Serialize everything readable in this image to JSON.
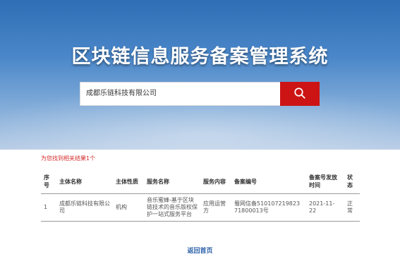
{
  "header": {
    "title": "区块链信息服务备案管理系统"
  },
  "search": {
    "value": "成都乐链科技有限公司",
    "button_icon": "search-icon",
    "button_color": "#cc1414"
  },
  "results": {
    "count_text": "为您找到相关结果1个",
    "columns": [
      "序号",
      "主体名称",
      "主体性质",
      "服务名称",
      "服务内容",
      "备案编号",
      "备案号发放时间",
      "状态"
    ],
    "rows": [
      {
        "seq": "1",
        "name": "成都乐链科技有限公司",
        "nature": "机构",
        "service": "音乐蜜蜂-基于区块链技术的音乐版权保护一站式服务平台",
        "content": "应用运营方",
        "record_no": "蜀网信备51010721982371800013号",
        "date": "2021-11-22",
        "status": "正常"
      }
    ]
  },
  "footer": {
    "back_label": "返回首页"
  }
}
